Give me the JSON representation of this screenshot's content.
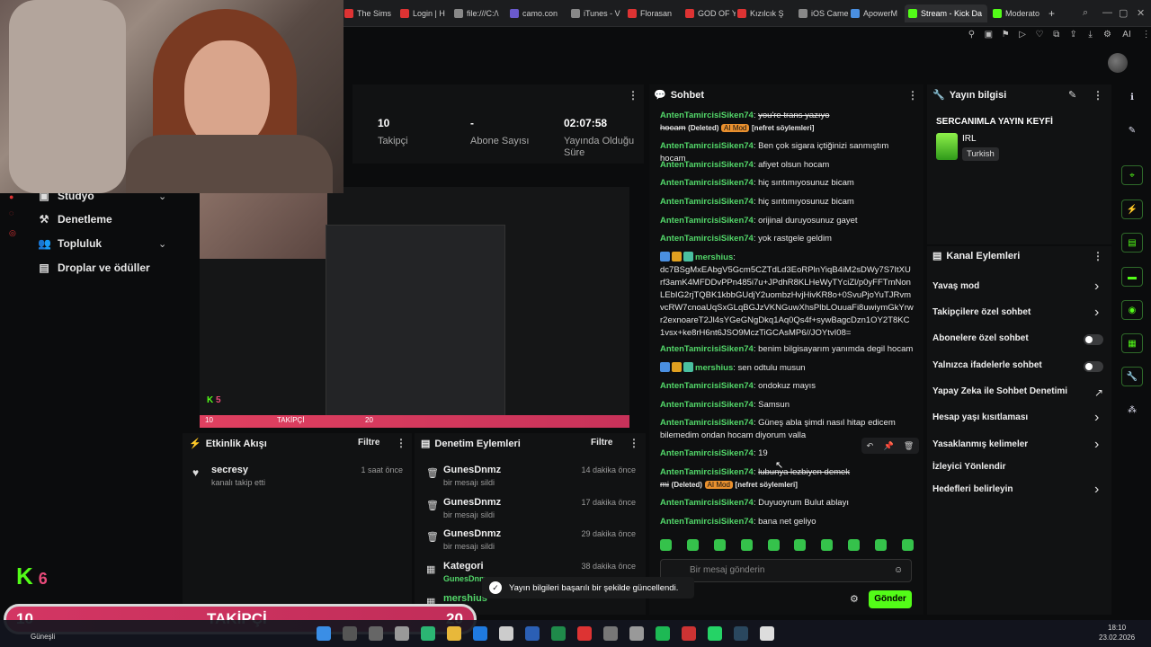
{
  "browser": {
    "tabs": [
      {
        "label": "The Sims",
        "color": "#d33"
      },
      {
        "label": "Login | H",
        "color": "#d33"
      },
      {
        "label": "file:///C:/\\",
        "color": "#888"
      },
      {
        "label": "camo.con",
        "color": "#6a5acd"
      },
      {
        "label": "iTunes - V",
        "color": "#888"
      },
      {
        "label": "Florasan",
        "color": "#d33"
      },
      {
        "label": "GOD OF Y",
        "color": "#d33"
      },
      {
        "label": "Kızılcık Ş",
        "color": "#d33"
      },
      {
        "label": "iOS Came",
        "color": "#888"
      },
      {
        "label": "ApowerM",
        "color": "#4a8fe0"
      },
      {
        "label": "Stream - Kick Da",
        "color": "#53fc18",
        "active": true
      },
      {
        "label": "Moderato",
        "color": "#53fc18"
      }
    ],
    "new_tab": "+",
    "toolbar_ai": "AI"
  },
  "sidebar": {
    "items": [
      {
        "label": "Stüdyo",
        "icon": "studio-icon",
        "chev": true
      },
      {
        "label": "Denetleme",
        "icon": "gavel-icon",
        "chev": false
      },
      {
        "label": "Topluluk",
        "icon": "people-icon",
        "chev": true
      },
      {
        "label": "Droplar ve ödüller",
        "icon": "gift-icon",
        "chev": false
      }
    ]
  },
  "stats": {
    "followers_value": "10",
    "followers_label": "Takipçi",
    "subs_value": "-",
    "subs_label": "Abone Sayısı",
    "live_value": "02:07:58",
    "live_label_1": "Yayında Olduğu",
    "live_label_2": "Süre"
  },
  "preview": {
    "bar_min": "10",
    "bar_label": "TAKİPÇİ",
    "bar_max": "20",
    "k_count": "5"
  },
  "activity": {
    "title": "Etkinlik Akışı",
    "filter": "Filtre",
    "items": [
      {
        "name": "secresy",
        "sub": "kanalı takip etti",
        "time": "1 saat önce"
      }
    ]
  },
  "moderation": {
    "title": "Denetim Eylemleri",
    "filter": "Filtre",
    "items": [
      {
        "name": "GunesDnmz",
        "sub": "bir mesajı sildi",
        "time": "14 dakika önce"
      },
      {
        "name": "GunesDnmz",
        "sub": "bir mesajı sildi",
        "time": "17 dakika önce"
      },
      {
        "name": "GunesDnmz",
        "sub": "bir mesajı sildi",
        "time": "29 dakika önce"
      },
      {
        "name": "Kategori",
        "sub": "GunesDnm",
        "time": "38 dakika önce"
      },
      {
        "name": "mershius",
        "sub": "",
        "time": ""
      }
    ]
  },
  "chat": {
    "title": "Sohbet",
    "messages": [
      {
        "user": "AntenTamircisiSiken74",
        "text": "you're trans yazıyo",
        "text2": "hocam",
        "deleted": "(Deleted)",
        "ai": "AI Mod",
        "tag": "[nefret söylemleri]"
      },
      {
        "user": "AntenTamircisiSiken74",
        "text": "Ben çok sigara içtiğinizi sanmıştım hocam"
      },
      {
        "user": "AntenTamircisiSiken74",
        "text": "afiyet olsun hocam"
      },
      {
        "user": "AntenTamircisiSiken74",
        "text": "hiç sıntımıyosunuz bicam"
      },
      {
        "user": "AntenTamircisiSiken74",
        "text": "hiç sıntımıyosunuz bicam"
      },
      {
        "user": "AntenTamircisiSiken74",
        "text": "orijinal duruyosunuz gayet"
      },
      {
        "user": "AntenTamircisiSiken74",
        "text": "yok rastgele geldim"
      },
      {
        "user": "mershius",
        "text": "dc7BSgMxEAbgV5Gcm5CZTdLd3EoRPlnYiqB4iM2sDWy7S7ItXUrf3amK4MFDDvPPn485i7u+JPdhR8KLHeWyTYciZl/p0yFFTmNonLEbIG2rjTQBK1kbbGUdjY2uombzHvjHivKR8o+0SvuPjoYuTJRvmvcRW7cnoaUqSxGLqBGJzVKNGuwXhsPlbLOuuaFi8uwiymGkYrwr2exnoareT2Jl4sYGeGNgDkq1Aq0Qs4f+sywBagcDzn1OY2T8KC1vsx+ke8rH6nt6JSO9MczTiGCAsMP6//JOYtvI08="
      },
      {
        "user": "AntenTamircisiSiken74",
        "text": "benim bilgisayarım yanımda degil hocam"
      },
      {
        "user": "mershius",
        "text": "sen odtulu musun"
      },
      {
        "user": "AntenTamircisiSiken74",
        "text": "ondokuz mayıs"
      },
      {
        "user": "AntenTamircisiSiken74",
        "text": "Samsun"
      },
      {
        "user": "AntenTamircisiSiken74",
        "text": "Güneş abla şimdi nasıl hitap edicem bilemedim ondan hocam diyorum valla"
      },
      {
        "user": "AntenTamircisiSiken74",
        "text": "19"
      },
      {
        "user": "AntenTamircisiSiken74",
        "text": "lubunya lezbiyen demek",
        "text2": "mi",
        "deleted": "(Deleted)",
        "ai": "AI Mod",
        "tag": "[nefret söylemleri]"
      },
      {
        "user": "AntenTamircisiSiken74",
        "text": "Duyuoyrum Bulut ablayı"
      },
      {
        "user": "AntenTamircisiSiken74",
        "text": "bana net geliyo"
      }
    ],
    "input_placeholder": "Bir mesaj gönderin",
    "send_label": "Gönder"
  },
  "stream_info": {
    "title": "Yayın bilgisi",
    "stream_title": "SERCANIMLA YAYIN KEYFİ",
    "category": "IRL",
    "language": "Turkish"
  },
  "channel_actions": {
    "title": "Kanal Eylemleri",
    "items": [
      {
        "label": "Yavaş mod",
        "type": "chev"
      },
      {
        "label": "Takipçilere özel sohbet",
        "type": "chev"
      },
      {
        "label": "Abonelere özel sohbet",
        "type": "toggle"
      },
      {
        "label": "Yalnızca ifadelerle sohbet",
        "type": "toggle"
      },
      {
        "label": "Yapay Zeka ile Sohbet Denetimi",
        "type": "link"
      },
      {
        "label": "Hesap yaşı kısıtlaması",
        "type": "chev"
      },
      {
        "label": "Yasaklanmış kelimeler",
        "type": "chev"
      },
      {
        "label": "İzleyici Yönlendir",
        "type": "none"
      },
      {
        "label": "Hedefleri belirleyin",
        "type": "chev"
      }
    ]
  },
  "toast": {
    "text": "Yayın bilgileri başarılı bir şekilde güncellendi."
  },
  "overlay": {
    "k_count": "6",
    "bar_min": "10",
    "bar_label": "TAKİPÇİ",
    "bar_max": "20",
    "progress": 0.0
  },
  "taskbar": {
    "time": "18:10",
    "date": "23.02.2026",
    "weather": "Güneşli"
  },
  "colors": {
    "accent": "#53fc18",
    "username": "#53d86a",
    "follow_bar": "#d33663"
  }
}
